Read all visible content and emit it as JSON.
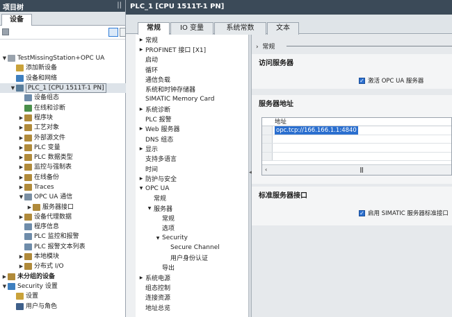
{
  "tree": {
    "title": "项目树",
    "pin": "||",
    "tab": "设备",
    "rows": [
      {
        "label": "TestMissingStation+OPC UA",
        "indent": 0,
        "arrow": "▼",
        "color": "#9aa3ad",
        "bold": false
      },
      {
        "label": "添加新设备",
        "indent": 1,
        "arrow": "",
        "color": "#c9a23a",
        "bold": false
      },
      {
        "label": "设备和网络",
        "indent": 1,
        "arrow": "",
        "color": "#3e7fbf",
        "bold": false
      },
      {
        "label": "PLC_1 [CPU 1511T-1 PN]",
        "indent": 1,
        "arrow": "▼",
        "color": "#5a7d9a",
        "bold": false,
        "sel": true
      },
      {
        "label": "设备组态",
        "indent": 2,
        "arrow": "",
        "color": "#6e8caa",
        "bold": false
      },
      {
        "label": "在线和诊断",
        "indent": 2,
        "arrow": "",
        "color": "#4a8f4a",
        "bold": false
      },
      {
        "label": "程序块",
        "indent": 2,
        "arrow": "▶",
        "color": "#b08a3a",
        "bold": false
      },
      {
        "label": "工艺对象",
        "indent": 2,
        "arrow": "▶",
        "color": "#b08a3a",
        "bold": false
      },
      {
        "label": "外部源文件",
        "indent": 2,
        "arrow": "▶",
        "color": "#b08a3a",
        "bold": false
      },
      {
        "label": "PLC 变量",
        "indent": 2,
        "arrow": "▶",
        "color": "#b08a3a",
        "bold": false
      },
      {
        "label": "PLC 数据类型",
        "indent": 2,
        "arrow": "▶",
        "color": "#b08a3a",
        "bold": false
      },
      {
        "label": "监控与强制表",
        "indent": 2,
        "arrow": "▶",
        "color": "#b08a3a",
        "bold": false
      },
      {
        "label": "在线备份",
        "indent": 2,
        "arrow": "▶",
        "color": "#b08a3a",
        "bold": false
      },
      {
        "label": "Traces",
        "indent": 2,
        "arrow": "▶",
        "color": "#b08a3a",
        "bold": false
      },
      {
        "label": "OPC UA 通信",
        "indent": 2,
        "arrow": "▼",
        "color": "#7a8fa3",
        "bold": false
      },
      {
        "label": "服务器接口",
        "indent": 3,
        "arrow": "▶",
        "color": "#b08a3a",
        "bold": false
      },
      {
        "label": "设备代理数据",
        "indent": 2,
        "arrow": "▶",
        "color": "#b08a3a",
        "bold": false
      },
      {
        "label": "程序信息",
        "indent": 2,
        "arrow": "",
        "color": "#6e8caa",
        "bold": false
      },
      {
        "label": "PLC 监控和报警",
        "indent": 2,
        "arrow": "",
        "color": "#6e8caa",
        "bold": false
      },
      {
        "label": "PLC 报警文本列表",
        "indent": 2,
        "arrow": "",
        "color": "#6e8caa",
        "bold": false
      },
      {
        "label": "本地模块",
        "indent": 2,
        "arrow": "▶",
        "color": "#b08a3a",
        "bold": false
      },
      {
        "label": "分布式 I/O",
        "indent": 2,
        "arrow": "▶",
        "color": "#b08a3a",
        "bold": false
      },
      {
        "label": "未分组的设备",
        "indent": 0,
        "arrow": "▶",
        "color": "#b08a3a",
        "bold": true
      },
      {
        "label": "Security 设置",
        "indent": 0,
        "arrow": "▼",
        "color": "#3e7fbf",
        "bold": false
      },
      {
        "label": "设置",
        "indent": 1,
        "arrow": "",
        "color": "#c9a23a",
        "bold": false
      },
      {
        "label": "用户与角色",
        "indent": 1,
        "arrow": "",
        "color": "#3e5f8a",
        "bold": false
      }
    ]
  },
  "editor": {
    "title": "PLC_1 [CPU 1511T-1 PN]",
    "tabs": [
      "常规",
      "IO 变量",
      "系统常数",
      "文本"
    ],
    "nav": [
      {
        "label": "常规",
        "indent": 0,
        "arrow": "▶"
      },
      {
        "label": "PROFINET 接口 [X1]",
        "indent": 0,
        "arrow": "▶"
      },
      {
        "label": "启动",
        "indent": 0,
        "arrow": ""
      },
      {
        "label": "循环",
        "indent": 0,
        "arrow": ""
      },
      {
        "label": "通信负载",
        "indent": 0,
        "arrow": ""
      },
      {
        "label": "系统和时钟存储器",
        "indent": 0,
        "arrow": ""
      },
      {
        "label": "SIMATIC Memory Card",
        "indent": 0,
        "arrow": ""
      },
      {
        "label": "系统诊断",
        "indent": 0,
        "arrow": "▶"
      },
      {
        "label": "PLC 报警",
        "indent": 0,
        "arrow": ""
      },
      {
        "label": "Web 服务器",
        "indent": 0,
        "arrow": "▶"
      },
      {
        "label": "DNS 组态",
        "indent": 0,
        "arrow": ""
      },
      {
        "label": "显示",
        "indent": 0,
        "arrow": "▶"
      },
      {
        "label": "支持多语言",
        "indent": 0,
        "arrow": ""
      },
      {
        "label": "时间",
        "indent": 0,
        "arrow": ""
      },
      {
        "label": "防护与安全",
        "indent": 0,
        "arrow": "▶"
      },
      {
        "label": "OPC UA",
        "indent": 0,
        "arrow": "▼"
      },
      {
        "label": "常规",
        "indent": 1,
        "arrow": ""
      },
      {
        "label": "服务器",
        "indent": 1,
        "arrow": "▼"
      },
      {
        "label": "常规",
        "indent": 2,
        "arrow": "",
        "sel": true
      },
      {
        "label": "选项",
        "indent": 2,
        "arrow": ""
      },
      {
        "label": "Security",
        "indent": 2,
        "arrow": "▼"
      },
      {
        "label": "Secure Channel",
        "indent": 3,
        "arrow": ""
      },
      {
        "label": "用户身份认证",
        "indent": 3,
        "arrow": ""
      },
      {
        "label": "导出",
        "indent": 2,
        "arrow": ""
      },
      {
        "label": "系统电源",
        "indent": 0,
        "arrow": "▶"
      },
      {
        "label": "组态控制",
        "indent": 0,
        "arrow": ""
      },
      {
        "label": "连接资源",
        "indent": 0,
        "arrow": ""
      },
      {
        "label": "地址总览",
        "indent": 0,
        "arrow": ""
      }
    ],
    "breadcrumb": "常规",
    "access": {
      "title": "访问服务器",
      "checkbox_label": "激活 OPC UA 服务器"
    },
    "address": {
      "title": "服务器地址",
      "column": "地址",
      "value": "opc.tcp://166.166.1.1:4840"
    },
    "standard": {
      "title": "标准服务器接口",
      "checkbox_label": "启用 SIMATIC 服务器标准接口"
    }
  }
}
